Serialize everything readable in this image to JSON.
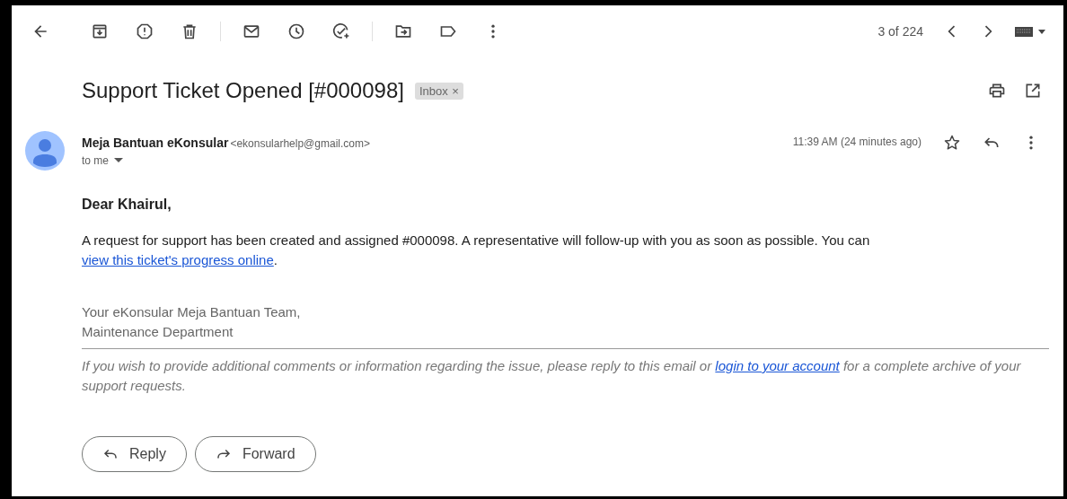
{
  "toolbar": {
    "pager": "3 of 224"
  },
  "subject": "Support Ticket Opened [#000098]",
  "label_chip": {
    "label": "Inbox",
    "remove": "×"
  },
  "message": {
    "sender_name": "Meja Bantuan eKonsular",
    "sender_email": "<ekonsularhelp@gmail.com>",
    "recipient": "to me",
    "time": "11:39 AM (24 minutes ago)",
    "starred": false
  },
  "body": {
    "greeting": "Dear Khairul,",
    "paragraph": {
      "before": "A request for support has been created and assigned #000098. A representative will follow-up with you as soon as possible. You can ",
      "link": "view this ticket's progress online",
      "after": "."
    },
    "signature": [
      "Your eKonsular Meja Bantuan Team,",
      "Maintenance Department"
    ],
    "footer": {
      "before": "If you wish to provide additional comments or information regarding the issue, please reply to this email or ",
      "link": "login to your account",
      "after": " for a complete archive of your support requests."
    }
  },
  "actions": [
    {
      "kind": "reply",
      "label": "Reply"
    },
    {
      "kind": "forward",
      "label": "Forward"
    }
  ]
}
